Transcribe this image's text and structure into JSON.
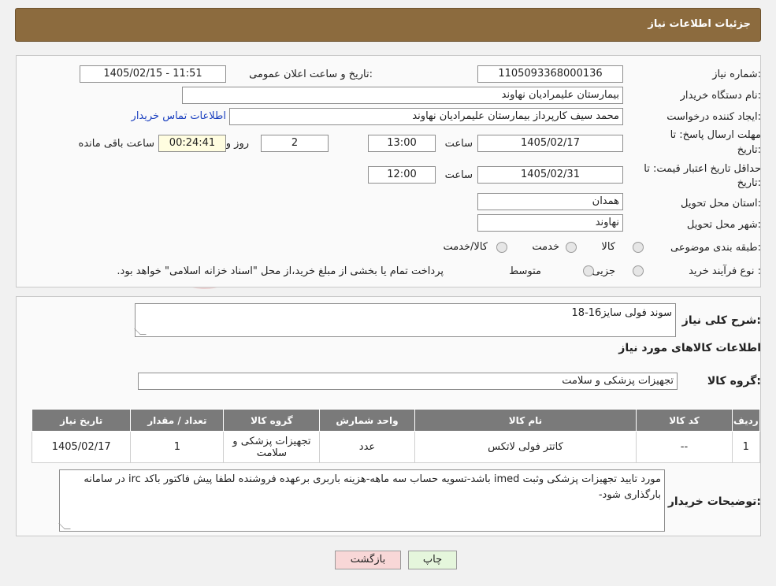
{
  "header": {
    "title": "جزئیات اطلاعات نیاز"
  },
  "form": {
    "need_number_label": "شماره نیاز:",
    "need_number": "1105093368000136",
    "announce_label": "تاریخ و ساعت اعلان عمومی:",
    "announce_value": "1405/02/15 - 11:51",
    "buyer_org_label": "نام دستگاه خریدار:",
    "buyer_org": "بیمارستان علیمرادیان نهاوند",
    "requester_label": "ایجاد کننده درخواست:",
    "requester": "محمد سیف کارپرداز بیمارستان علیمرادیان نهاوند",
    "contact_link": "اطلاعات تماس خریدار",
    "deadline_label_1": "مهلت ارسال پاسخ: تا",
    "deadline_label_2": "تاریخ:",
    "deadline_date": "1405/02/17",
    "time_label": "ساعت",
    "deadline_time": "13:00",
    "days_value": "2",
    "days_label": "روز و",
    "remaining_time": "00:24:41",
    "remaining_label": "ساعت باقی مانده",
    "validity_label_1": "حداقل تاریخ اعتبار قیمت: تا",
    "validity_label_2": "تاریخ:",
    "validity_date": "1405/02/31",
    "validity_time": "12:00",
    "province_label": "استان محل تحویل:",
    "province": "همدان",
    "city_label": "شهر محل تحویل:",
    "city": "نهاوند",
    "category_label": "طبقه بندی موضوعی:",
    "category_options": [
      "کالا",
      "خدمت",
      "کالا/خدمت"
    ],
    "process_label": "نوع فرآیند خرید :",
    "process_options": [
      "جزیی",
      "متوسط"
    ],
    "process_note": "پرداخت تمام یا بخشی از مبلغ خرید،از محل \"اسناد خزانه اسلامی\" خواهد بود."
  },
  "summary": {
    "label": "شرح کلی نیاز:",
    "value": "سوند فولی سایز16-18",
    "items_title": "اطلاعات کالاهای مورد نیاز",
    "group_label": "گروه کالا:",
    "group_value": "تجهیزات پزشکی و سلامت"
  },
  "table": {
    "headers": [
      "ردیف",
      "کد کالا",
      "نام کالا",
      "واحد شمارش",
      "گروه کالا",
      "تعداد / مقدار",
      "تاریخ نیاز"
    ],
    "rows": [
      [
        "1",
        "--",
        "کاتتر فولی لاتکس",
        "عدد",
        "تجهیزات پزشکی و سلامت",
        "1",
        "1405/02/17"
      ]
    ]
  },
  "notes": {
    "label": "توضیحات خریدار:",
    "value": "مورد تایید تجهیزات پزشکی وثبت imed باشد-تسویه حساب سه ماهه-هزینه باربری برعهده فروشنده لطفا پیش فاکتور باکد irc در سامانه بارگذاری شود-"
  },
  "buttons": {
    "print": "چاپ",
    "back": "بازگشت"
  },
  "colors": {
    "header": "#8c6b3e",
    "table_header": "#7a7a7a",
    "link": "#1a3fbf"
  }
}
